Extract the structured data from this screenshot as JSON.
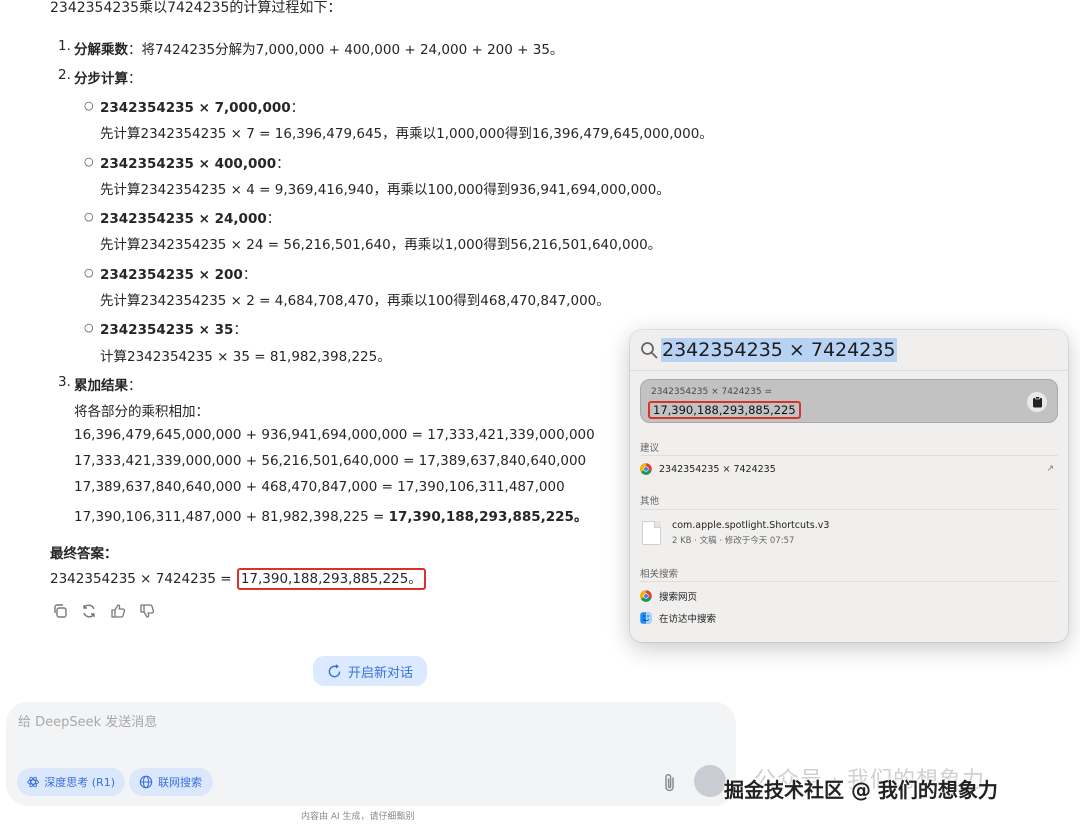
{
  "answer": {
    "intro": "2342354235乘以7424235的计算过程如下：",
    "steps": [
      {
        "num": "1.",
        "title": "分解乘数",
        "desc": "：将7424235分解为7,000,000 + 400,000 + 24,000 + 200 + 35。"
      },
      {
        "num": "2.",
        "title": "分步计算",
        "desc": "："
      },
      {
        "num": "3.",
        "title": "累加结果",
        "desc": "："
      }
    ],
    "sub_steps": [
      {
        "title": "2342354235 × 7,000,000",
        "colon": "：",
        "desc": "先计算2342354235 × 7 = 16,396,479,645，再乘以1,000,000得到16,396,479,645,000,000。"
      },
      {
        "title": "2342354235 × 400,000",
        "colon": "：",
        "desc": "先计算2342354235 × 4 = 9,369,416,940，再乘以100,000得到936,941,694,000,000。"
      },
      {
        "title": "2342354235 × 24,000",
        "colon": "：",
        "desc": "先计算2342354235 × 24 = 56,216,501,640，再乘以1,000得到56,216,501,640,000。"
      },
      {
        "title": "2342354235 × 200",
        "colon": "：",
        "desc": "先计算2342354235 × 2 = 4,684,708,470，再乘以100得到468,470,847,000。"
      },
      {
        "title": "2342354235 × 35",
        "colon": "：",
        "desc": "计算2342354235 × 35 = 81,982,398,225。"
      }
    ],
    "sum_intro": "将各部分的乘积相加：",
    "sum_lines": [
      "16,396,479,645,000,000 + 936,941,694,000,000 = 17,333,421,339,000,000",
      "17,333,421,339,000,000 + 56,216,501,640,000 = 17,389,637,840,640,000",
      "17,389,637,840,640,000 + 468,470,847,000 = 17,390,106,311,487,000"
    ],
    "sum_last_prefix": "17,390,106,311,487,000 + 81,982,398,225 = ",
    "sum_last_bold": "17,390,188,293,885,225。",
    "final_label": "最终答案：",
    "final_prefix": "2342354235 × 7424235 = ",
    "final_value": "17,390,188,293,885,225。"
  },
  "actions": {
    "icons": [
      "copy-icon",
      "regenerate-icon",
      "thumbs-up-icon",
      "thumbs-down-icon"
    ]
  },
  "new_chat_label": "开启新对话",
  "composer": {
    "placeholder": "给 DeepSeek 发送消息",
    "deep_think_label": "深度思考 (R1)",
    "web_search_label": "联网搜索"
  },
  "disclaimer": "内容由 AI 生成，请仔细甄别",
  "watermark": {
    "faint": "公众号 · 我们的想象力",
    "bold": "掘金技术社区 @ 我们的想象力"
  },
  "spotlight": {
    "query": "2342354235 × 7424235",
    "calc_expr": "2342354235 × 7424235 =",
    "calc_result": "17,390,188,293,885,225",
    "suggest_label": "建议",
    "suggest_item": "2342354235 × 7424235",
    "other_label": "其他",
    "file_name": "com.apple.spotlight.Shortcuts.v3",
    "file_meta": "2 KB · 文稿 · 修改于今天 07:57",
    "related_label": "相关搜索",
    "related_items": [
      "搜索网页",
      "在访达中搜索"
    ]
  },
  "colors": {
    "highlight_box": "#d9322b",
    "accent_blue": "#3b6fe0",
    "pill_bg": "#dbe7fb",
    "query_selection": "#b7d2f3"
  }
}
